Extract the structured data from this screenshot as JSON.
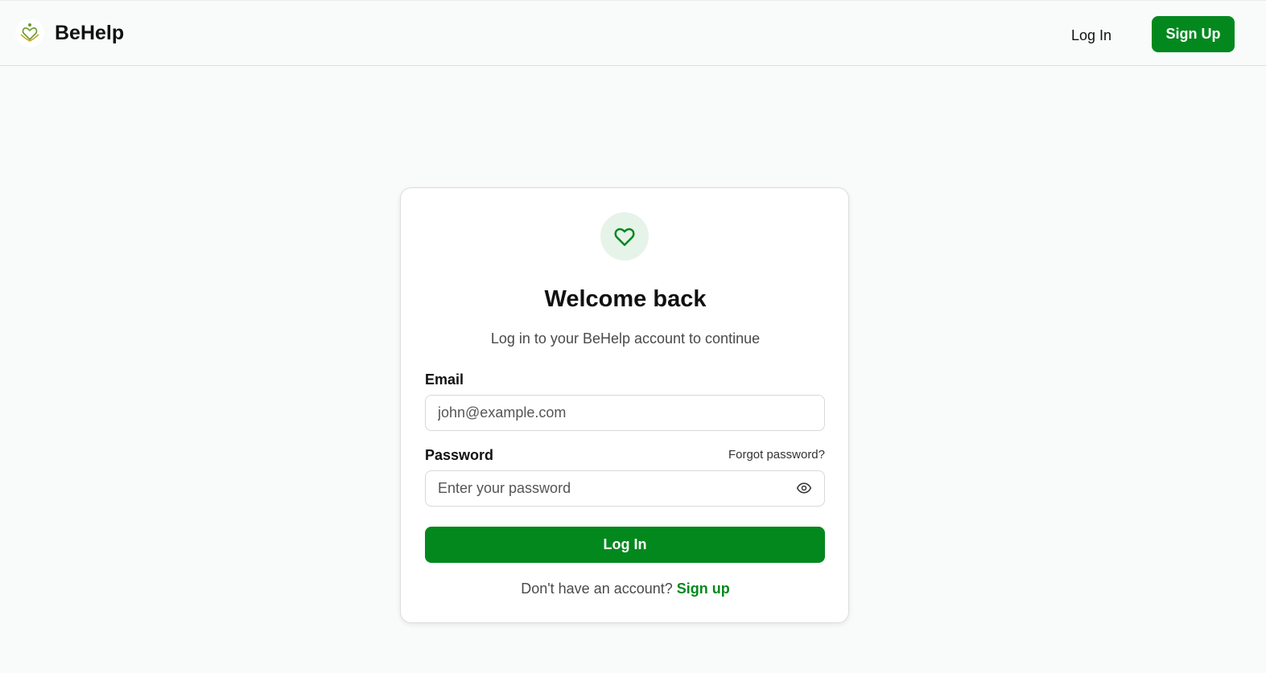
{
  "header": {
    "brand_name": "BeHelp",
    "logo_icon": "heart-hands-logo",
    "login_label": "Log In",
    "signup_label": "Sign Up"
  },
  "card": {
    "icon": "heart-icon",
    "title": "Welcome back",
    "subtitle": "Log in to your BeHelp account to continue",
    "email_label": "Email",
    "email_placeholder": "john@example.com",
    "email_value": "",
    "password_label": "Password",
    "forgot_label": "Forgot password?",
    "password_placeholder": "Enter your password",
    "password_value": "",
    "eye_icon": "eye-icon",
    "submit_label": "Log In",
    "footer_text": "Don't have an account?",
    "footer_link": "Sign up"
  },
  "colors": {
    "accent": "#03881e",
    "badge_bg": "#e6f3e9",
    "page_bg": "#f9fafa"
  }
}
